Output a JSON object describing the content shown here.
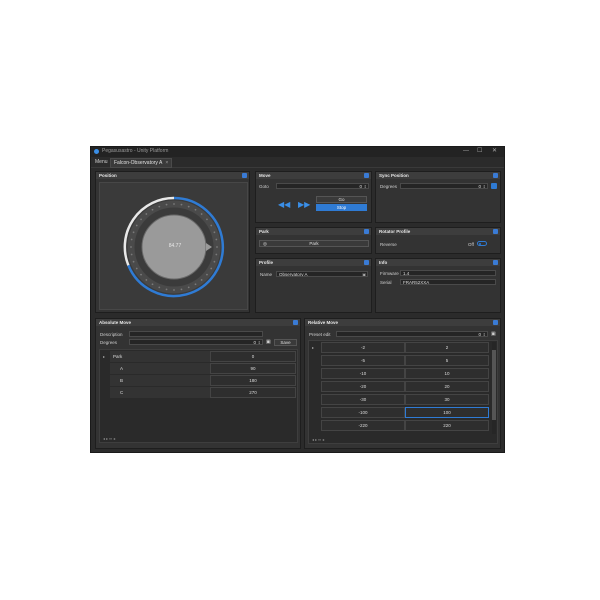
{
  "window": {
    "title": "Pegasusastro - Unity Platform",
    "controls": [
      "—",
      "☐",
      "✕"
    ]
  },
  "menu": {
    "label": "Menu"
  },
  "tab": {
    "label": "Falcon-Observatory A",
    "close": "×"
  },
  "position_panel": {
    "title": "Position",
    "dial_value": "84.77"
  },
  "move_panel": {
    "title": "Move",
    "goto_label": "Goto",
    "goto_value": "0",
    "go_label": "Go",
    "stop_label": "Stop"
  },
  "sync_panel": {
    "title": "Sync Position",
    "degrees_label": "Degrees",
    "degrees_value": "0"
  },
  "park_panel": {
    "title": "Park",
    "park_button": "Park"
  },
  "rotator_profile_panel": {
    "title": "Rotator Profile",
    "reverse_label": "Reverse",
    "reverse_state": "Off"
  },
  "profile_panel": {
    "title": "Profile",
    "name_label": "Name",
    "name_value": "Observatory A"
  },
  "info_panel": {
    "title": "Info",
    "firmware_label": "Firmware",
    "firmware_value": "1.4",
    "serial_label": "Serial",
    "serial_value": "FRAR52XXA"
  },
  "absolute_move_panel": {
    "title": "Absolute Move",
    "description_label": "Description",
    "description_value": "",
    "degrees_label": "Degrees",
    "degrees_value": "0",
    "save_label": "Save",
    "rows": [
      {
        "name": "Park",
        "value": "0"
      },
      {
        "name": "A",
        "value": "90"
      },
      {
        "name": "B",
        "value": "180"
      },
      {
        "name": "C",
        "value": "270"
      }
    ]
  },
  "relative_move_panel": {
    "title": "Relative Move",
    "preset_label": "Preset edit",
    "preset_value": "0",
    "rows": [
      [
        "-2",
        "2"
      ],
      [
        "-5",
        "5"
      ],
      [
        "-10",
        "10"
      ],
      [
        "-20",
        "20"
      ],
      [
        "-30",
        "30"
      ],
      [
        "-100",
        "100"
      ],
      [
        "-220",
        "220"
      ]
    ]
  },
  "colors": {
    "accent": "#2f7bd4",
    "background": "#2b2b2b",
    "panel": "#333333"
  }
}
